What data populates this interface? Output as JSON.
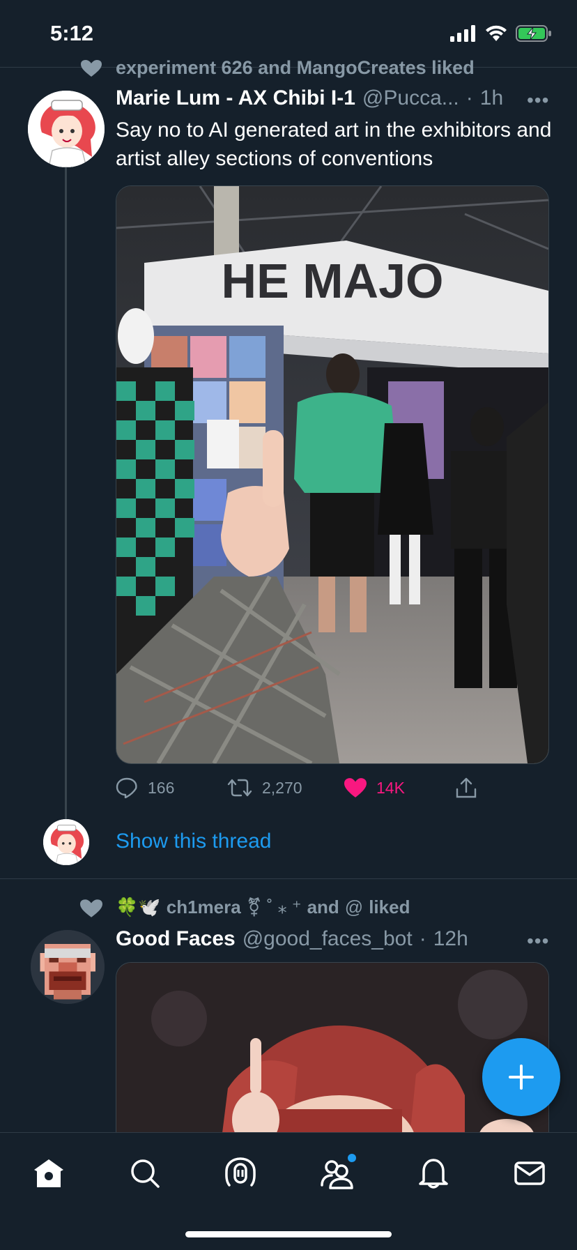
{
  "status_bar": {
    "time": "5:12",
    "icons": [
      "signal-icon",
      "wifi-icon",
      "battery-charging-icon"
    ],
    "battery_color": "#34c759"
  },
  "tweet1": {
    "social_context": "experiment 626 and MangoCreates liked",
    "display_name": "Marie Lum - AX Chibi I-1",
    "handle": "@Pucca...",
    "dot": "·",
    "time": "1h",
    "more": "•••",
    "text": "Say no to AI generated art in the exhibitors and artist alley sections of conventions",
    "booth_sign": "HE MAJO",
    "replies": "166",
    "retweets": "2,270",
    "likes": "14K",
    "liked": true,
    "like_color": "#f91880",
    "show_thread": "Show this thread"
  },
  "tweet2": {
    "social_context_emoji": "🍀🕊️",
    "social_context_name": "ch1mera",
    "social_context_symbols": "⚧ ˚ ⁎ ⁺",
    "social_context_and": "and",
    "social_context_spiral": "@",
    "social_context_liked": "liked",
    "display_name": "Good Faces",
    "handle": "@good_faces_bot",
    "dot": "·",
    "time": "12h",
    "more": "•••"
  },
  "fab": {
    "icon": "plus-icon",
    "color": "#1d9bf0"
  },
  "tab_bar": {
    "items": [
      "home-icon",
      "search-icon",
      "spaces-icon",
      "communities-icon",
      "notifications-icon",
      "messages-icon"
    ]
  },
  "accent_color": "#1d9bf0"
}
